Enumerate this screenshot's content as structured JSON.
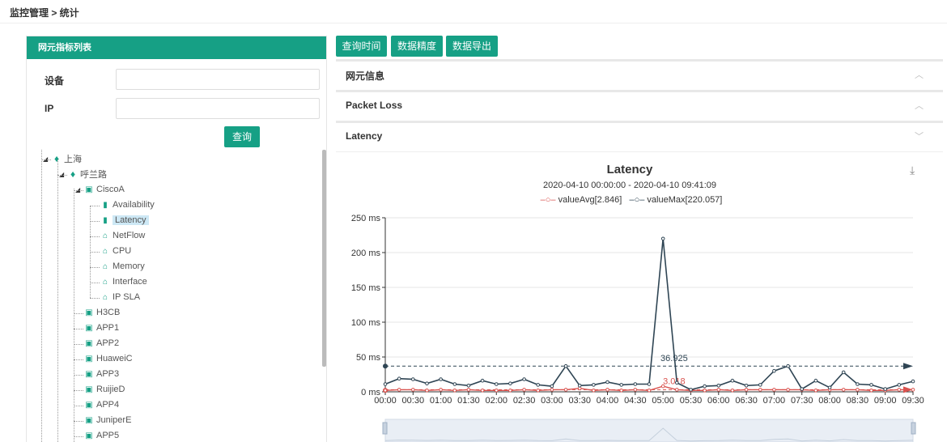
{
  "breadcrumb": "监控管理 > 统计",
  "left_panel": {
    "title": "网元指标列表",
    "device_label": "设备",
    "device_value": "",
    "ip_label": "IP",
    "ip_value": "",
    "query_button": "查询",
    "tree": [
      {
        "id": "n0",
        "label": "上海",
        "icon": "location-pin-icon",
        "level": 0,
        "expanded": true
      },
      {
        "id": "n1",
        "label": "呼兰路",
        "icon": "location-pin-icon",
        "level": 1,
        "expanded": true
      },
      {
        "id": "n2",
        "label": "CiscoA",
        "icon": "device-icon",
        "level": 2,
        "expanded": true
      },
      {
        "id": "n3",
        "label": "Availability",
        "icon": "bar-chart-icon",
        "level": 3
      },
      {
        "id": "n4",
        "label": "Latency",
        "icon": "bar-chart-icon",
        "level": 3,
        "selected": true
      },
      {
        "id": "n5",
        "label": "NetFlow",
        "icon": "home-icon",
        "level": 3
      },
      {
        "id": "n6",
        "label": "CPU",
        "icon": "home-icon",
        "level": 3
      },
      {
        "id": "n7",
        "label": "Memory",
        "icon": "home-icon",
        "level": 3
      },
      {
        "id": "n8",
        "label": "Interface",
        "icon": "home-icon",
        "level": 3
      },
      {
        "id": "n9",
        "label": "IP SLA",
        "icon": "home-icon",
        "level": 3
      },
      {
        "id": "n10",
        "label": "H3CB",
        "icon": "device-icon",
        "level": 2
      },
      {
        "id": "n11",
        "label": "APP1",
        "icon": "device-icon",
        "level": 2
      },
      {
        "id": "n12",
        "label": "APP2",
        "icon": "device-icon",
        "level": 2
      },
      {
        "id": "n13",
        "label": "HuaweiC",
        "icon": "device-icon",
        "level": 2
      },
      {
        "id": "n14",
        "label": "APP3",
        "icon": "device-icon",
        "level": 2
      },
      {
        "id": "n15",
        "label": "RuijieD",
        "icon": "device-icon",
        "level": 2
      },
      {
        "id": "n16",
        "label": "APP4",
        "icon": "device-icon",
        "level": 2
      },
      {
        "id": "n17",
        "label": "JuniperE",
        "icon": "device-icon",
        "level": 2
      },
      {
        "id": "n18",
        "label": "APP5",
        "icon": "device-icon",
        "level": 2
      }
    ]
  },
  "toolbar": {
    "query_time": "查询时间",
    "data_precision": "数据精度",
    "data_export": "数据导出"
  },
  "accordion": {
    "ne_info": "网元信息",
    "packet_loss": "Packet Loss",
    "latency": "Latency"
  },
  "colors": {
    "accent": "#16a085",
    "avg_series": "#d9534f",
    "max_series": "#2f4554"
  },
  "chart_data": {
    "type": "line",
    "title": "Latency",
    "subtitle": "2020-04-10 00:00:00 - 2020-04-10 09:41:09",
    "legend_position": "top-center",
    "grid": true,
    "y_ticks": [
      "250 ms",
      "200 ms",
      "150 ms",
      "100 ms",
      "50 ms",
      "0 ms"
    ],
    "ylim": [
      0,
      250
    ],
    "x_ticks": [
      "00:00",
      "00:30",
      "01:00",
      "01:30",
      "02:00",
      "02:30",
      "03:00",
      "03:30",
      "04:00",
      "04:30",
      "05:00",
      "05:30",
      "06:00",
      "06:30",
      "07:00",
      "07:30",
      "08:00",
      "08:30",
      "09:00",
      "09:30"
    ],
    "x_hours": [
      0,
      0.25,
      0.5,
      0.75,
      1,
      1.25,
      1.5,
      1.75,
      2,
      2.25,
      2.5,
      2.75,
      3,
      3.25,
      3.5,
      3.75,
      4,
      4.25,
      4.5,
      4.75,
      5,
      5.25,
      5.5,
      5.75,
      6,
      6.25,
      6.5,
      6.75,
      7,
      7.25,
      7.5,
      7.75,
      8,
      8.25,
      8.5,
      8.75,
      9,
      9.25,
      9.5
    ],
    "series": [
      {
        "name": "valueAvg[2.846]",
        "values": [
          2,
          3,
          3,
          2,
          3,
          2,
          3,
          2,
          2,
          2,
          3,
          2,
          3,
          3,
          5,
          2,
          3,
          2,
          3,
          2,
          8,
          3,
          2,
          2,
          3,
          2,
          3,
          3,
          3,
          3,
          3,
          2,
          3,
          3,
          3,
          2,
          2,
          3,
          3
        ],
        "markline": {
          "label": "3.018",
          "value": 3.018
        },
        "markpoint_start": 2
      },
      {
        "name": "valueMax[220.057]",
        "values": [
          11,
          19,
          18,
          12,
          18,
          11,
          9,
          16,
          11,
          12,
          18,
          10,
          8,
          37,
          9,
          10,
          14,
          10,
          11,
          11,
          220,
          13,
          3,
          8,
          9,
          16,
          9,
          10,
          30,
          37,
          4,
          16,
          6,
          28,
          11,
          10,
          4,
          10,
          15
        ],
        "markline": {
          "label": "36.925",
          "value": 36.925
        },
        "markpoint_start": 36.925
      }
    ]
  }
}
